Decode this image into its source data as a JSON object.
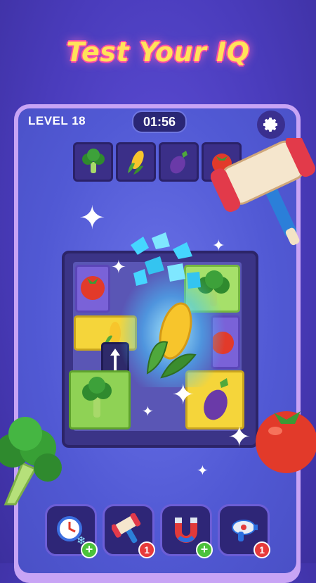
{
  "promo": {
    "headline": "Test Your IQ"
  },
  "hud": {
    "level": "LEVEL 18",
    "timer": "01:56",
    "settings_icon": "gear-icon"
  },
  "targets": [
    {
      "item": "broccoli",
      "icon": "broccoli-icon"
    },
    {
      "item": "corn",
      "icon": "corn-icon"
    },
    {
      "item": "eggplant",
      "icon": "eggplant-icon"
    },
    {
      "item": "tomato",
      "icon": "tomato-icon"
    }
  ],
  "board": {
    "tiles": [
      "tomato",
      "broccoli",
      "corn",
      "tomato",
      "broccoli",
      "eggplant"
    ],
    "highlight": "corn"
  },
  "powerups": [
    {
      "name": "freeze-timer",
      "icon": "clock-snowflake-icon",
      "badge": "+"
    },
    {
      "name": "hammer",
      "icon": "hammer-icon",
      "badge": "1"
    },
    {
      "name": "magnet",
      "icon": "magnet-icon",
      "badge": "+"
    },
    {
      "name": "ray-gun",
      "icon": "ray-gun-icon",
      "badge": "1"
    }
  ],
  "colors": {
    "background": "#4a3cbc",
    "frame": "#c8a4f5",
    "headline": "#ffe35a",
    "badge_plus": "#4cc23b",
    "badge_count": "#e73a3a"
  }
}
